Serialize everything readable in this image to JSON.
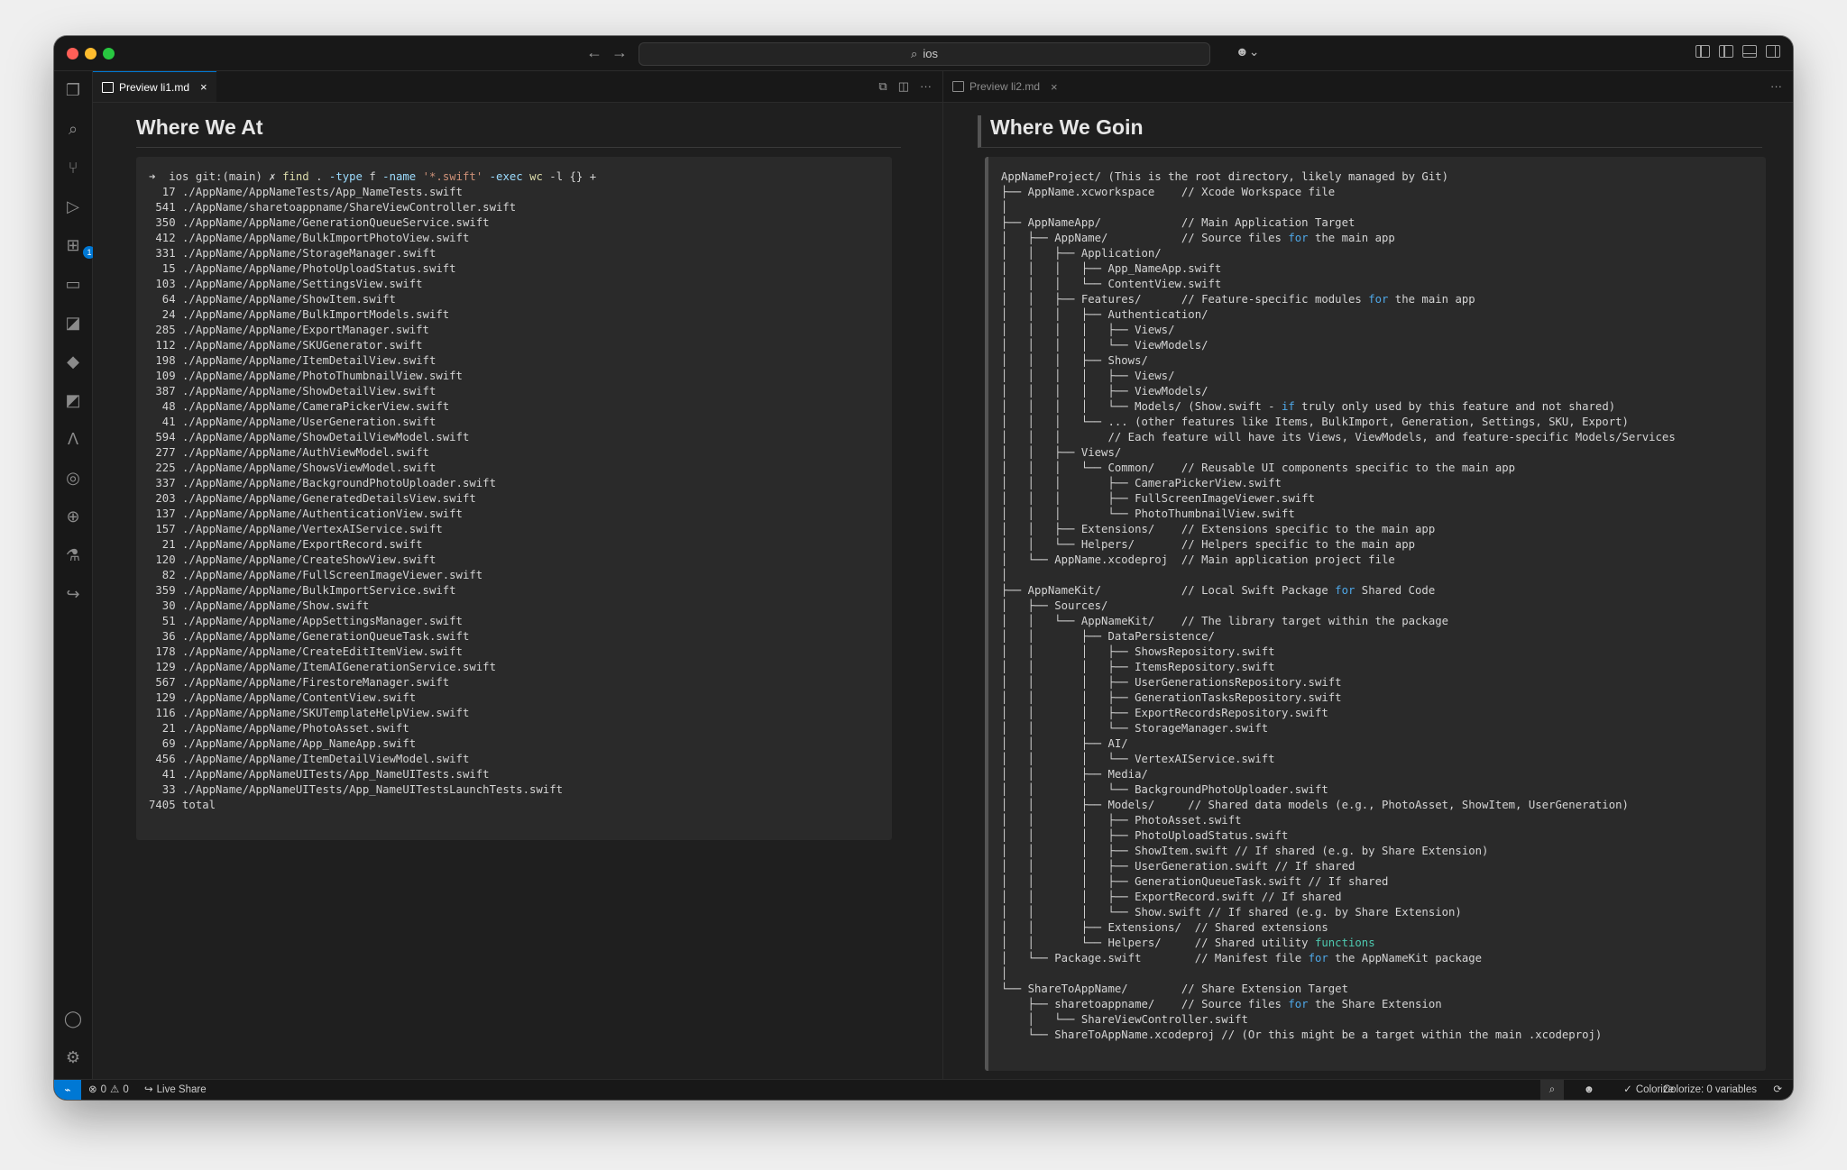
{
  "titlebar": {
    "search_text": "ios",
    "back_icon": "arrow-left-icon",
    "forward_icon": "arrow-right-icon"
  },
  "activity_bar": {
    "extensions_badge": "1"
  },
  "left_editor": {
    "tab_label": "Preview li1.md",
    "heading": "Where We At",
    "prompt": {
      "arrow": "➜",
      "text": "  ios git:(main) ✗ ",
      "cmd": "find",
      "arg1": " . ",
      "flag1": "-type",
      "arg2": " f ",
      "flag2": "-name",
      "arg3": " ",
      "str": "'*.swift'",
      "arg4": " ",
      "flag3": "-exec",
      "arg5": " ",
      "cmd2": "wc",
      "arg6": " -l {} +"
    },
    "output_lines": [
      "  17 ./AppName/AppNameTests/App_NameTests.swift",
      " 541 ./AppName/sharetoappname/ShareViewController.swift",
      " 350 ./AppName/AppName/GenerationQueueService.swift",
      " 412 ./AppName/AppName/BulkImportPhotoView.swift",
      " 331 ./AppName/AppName/StorageManager.swift",
      "  15 ./AppName/AppName/PhotoUploadStatus.swift",
      " 103 ./AppName/AppName/SettingsView.swift",
      "  64 ./AppName/AppName/ShowItem.swift",
      "  24 ./AppName/AppName/BulkImportModels.swift",
      " 285 ./AppName/AppName/ExportManager.swift",
      " 112 ./AppName/AppName/SKUGenerator.swift",
      " 198 ./AppName/AppName/ItemDetailView.swift",
      " 109 ./AppName/AppName/PhotoThumbnailView.swift",
      " 387 ./AppName/AppName/ShowDetailView.swift",
      "  48 ./AppName/AppName/CameraPickerView.swift",
      "  41 ./AppName/AppName/UserGeneration.swift",
      " 594 ./AppName/AppName/ShowDetailViewModel.swift",
      " 277 ./AppName/AppName/AuthViewModel.swift",
      " 225 ./AppName/AppName/ShowsViewModel.swift",
      " 337 ./AppName/AppName/BackgroundPhotoUploader.swift",
      " 203 ./AppName/AppName/GeneratedDetailsView.swift",
      " 137 ./AppName/AppName/AuthenticationView.swift",
      " 157 ./AppName/AppName/VertexAIService.swift",
      "  21 ./AppName/AppName/ExportRecord.swift",
      " 120 ./AppName/AppName/CreateShowView.swift",
      "  82 ./AppName/AppName/FullScreenImageViewer.swift",
      " 359 ./AppName/AppName/BulkImportService.swift",
      "  30 ./AppName/AppName/Show.swift",
      "  51 ./AppName/AppName/AppSettingsManager.swift",
      "  36 ./AppName/AppName/GenerationQueueTask.swift",
      " 178 ./AppName/AppName/CreateEditItemView.swift",
      " 129 ./AppName/AppName/ItemAIGenerationService.swift",
      " 567 ./AppName/AppName/FirestoreManager.swift",
      " 129 ./AppName/AppName/ContentView.swift",
      " 116 ./AppName/AppName/SKUTemplateHelpView.swift",
      "  21 ./AppName/AppName/PhotoAsset.swift",
      "  69 ./AppName/AppName/App_NameApp.swift",
      " 456 ./AppName/AppName/ItemDetailViewModel.swift",
      "  41 ./AppName/AppNameUITests/App_NameUITests.swift",
      "  33 ./AppName/AppNameUITests/App_NameUITestsLaunchTests.swift",
      "7405 total"
    ]
  },
  "right_editor": {
    "tab_label": "Preview li2.md",
    "heading": "Where We Goin",
    "tree_lines": [
      [
        [
          "AppNameProject/ (This is the root directory, likely managed by Git)",
          ""
        ]
      ],
      [
        [
          "├── AppName.xcworkspace    // Xcode Workspace file",
          ""
        ]
      ],
      [
        [
          "│",
          ""
        ]
      ],
      [
        [
          "├── AppNameApp/            // Main Application Target",
          ""
        ]
      ],
      [
        [
          "│   ├── AppName/           // Source files ",
          ""
        ],
        [
          "for",
          "kw"
        ],
        [
          " the main app",
          ""
        ]
      ],
      [
        [
          "│   │   ├── Application/",
          ""
        ]
      ],
      [
        [
          "│   │   │   ├── App_NameApp.swift",
          ""
        ]
      ],
      [
        [
          "│   │   │   └── ContentView.swift",
          ""
        ]
      ],
      [
        [
          "│   │   ├── Features/      // Feature-specific modules ",
          ""
        ],
        [
          "for",
          "kw"
        ],
        [
          " the main app",
          ""
        ]
      ],
      [
        [
          "│   │   │   ├── Authentication/",
          ""
        ]
      ],
      [
        [
          "│   │   │   │   ├── Views/",
          ""
        ]
      ],
      [
        [
          "│   │   │   │   └── ViewModels/",
          ""
        ]
      ],
      [
        [
          "│   │   │   ├── Shows/",
          ""
        ]
      ],
      [
        [
          "│   │   │   │   ├── Views/",
          ""
        ]
      ],
      [
        [
          "│   │   │   │   ├── ViewModels/",
          ""
        ]
      ],
      [
        [
          "│   │   │   │   └── Models/ (Show.swift - ",
          ""
        ],
        [
          "if",
          "kw"
        ],
        [
          " truly only used by this feature and not shared)",
          ""
        ]
      ],
      [
        [
          "│   │   │   └── ... (other features like Items, BulkImport, Generation, Settings, SKU, Export)",
          ""
        ]
      ],
      [
        [
          "│   │   │       // Each feature will have its Views, ViewModels, and feature-specific Models/Services",
          ""
        ]
      ],
      [
        [
          "│   │   ├── Views/",
          ""
        ]
      ],
      [
        [
          "│   │   │   └── Common/    // Reusable UI components specific to the main app",
          ""
        ]
      ],
      [
        [
          "│   │   │       ├── CameraPickerView.swift",
          ""
        ]
      ],
      [
        [
          "│   │   │       ├── FullScreenImageViewer.swift",
          ""
        ]
      ],
      [
        [
          "│   │   │       └── PhotoThumbnailView.swift",
          ""
        ]
      ],
      [
        [
          "│   │   ├── Extensions/    // Extensions specific to the main app",
          ""
        ]
      ],
      [
        [
          "│   │   └── Helpers/       // Helpers specific to the main app",
          ""
        ]
      ],
      [
        [
          "│   └── AppName.xcodeproj  // Main application project file",
          ""
        ]
      ],
      [
        [
          "│",
          ""
        ]
      ],
      [
        [
          "├── AppNameKit/            // Local Swift Package ",
          ""
        ],
        [
          "for",
          "kw"
        ],
        [
          " Shared Code",
          ""
        ]
      ],
      [
        [
          "│   ├── Sources/",
          ""
        ]
      ],
      [
        [
          "│   │   └── AppNameKit/    // The library target within the package",
          ""
        ]
      ],
      [
        [
          "│   │       ├── DataPersistence/",
          ""
        ]
      ],
      [
        [
          "│   │       │   ├── ShowsRepository.swift",
          ""
        ]
      ],
      [
        [
          "│   │       │   ├── ItemsRepository.swift",
          ""
        ]
      ],
      [
        [
          "│   │       │   ├── UserGenerationsRepository.swift",
          ""
        ]
      ],
      [
        [
          "│   │       │   ├── GenerationTasksRepository.swift",
          ""
        ]
      ],
      [
        [
          "│   │       │   ├── ExportRecordsRepository.swift",
          ""
        ]
      ],
      [
        [
          "│   │       │   └── StorageManager.swift",
          ""
        ]
      ],
      [
        [
          "│   │       ├── AI/",
          ""
        ]
      ],
      [
        [
          "│   │       │   └── VertexAIService.swift",
          ""
        ]
      ],
      [
        [
          "│   │       ├── Media/",
          ""
        ]
      ],
      [
        [
          "│   │       │   └── BackgroundPhotoUploader.swift",
          ""
        ]
      ],
      [
        [
          "│   │       ├── Models/     // Shared data models (e.g., PhotoAsset, ShowItem, UserGeneration)",
          ""
        ]
      ],
      [
        [
          "│   │       │   ├── PhotoAsset.swift",
          ""
        ]
      ],
      [
        [
          "│   │       │   ├── PhotoUploadStatus.swift",
          ""
        ]
      ],
      [
        [
          "│   │       │   ├── ShowItem.swift // If shared (e.g. by Share Extension)",
          ""
        ]
      ],
      [
        [
          "│   │       │   ├── UserGeneration.swift // If shared",
          ""
        ]
      ],
      [
        [
          "│   │       │   ├── GenerationQueueTask.swift // If shared",
          ""
        ]
      ],
      [
        [
          "│   │       │   ├── ExportRecord.swift // If shared",
          ""
        ]
      ],
      [
        [
          "│   │       │   └── Show.swift // If shared (e.g. by Share Extension)",
          ""
        ]
      ],
      [
        [
          "│   │       ├── Extensions/  // Shared extensions",
          ""
        ]
      ],
      [
        [
          "│   │       └── Helpers/     // Shared utility ",
          ""
        ],
        [
          "functions",
          "fn"
        ]
      ],
      [
        [
          "│   └── Package.swift        // Manifest file ",
          ""
        ],
        [
          "for",
          "kw"
        ],
        [
          " the AppNameKit package",
          ""
        ]
      ],
      [
        [
          "│",
          ""
        ]
      ],
      [
        [
          "└── ShareToAppName/        // Share Extension Target",
          ""
        ]
      ],
      [
        [
          "    ├── sharetoappname/    // Source files ",
          ""
        ],
        [
          "for",
          "kw"
        ],
        [
          " the Share Extension",
          ""
        ]
      ],
      [
        [
          "    │   └── ShareViewController.swift",
          ""
        ]
      ],
      [
        [
          "    └── ShareToAppName.xcodeproj // (Or this might be a target within the main .xcodeproj)",
          ""
        ]
      ]
    ]
  },
  "statusbar": {
    "errors": "0",
    "warnings": "0",
    "live_share": "Live Share",
    "colorize": "Colorize",
    "colorize_vars": "Colorize: 0 variables"
  }
}
